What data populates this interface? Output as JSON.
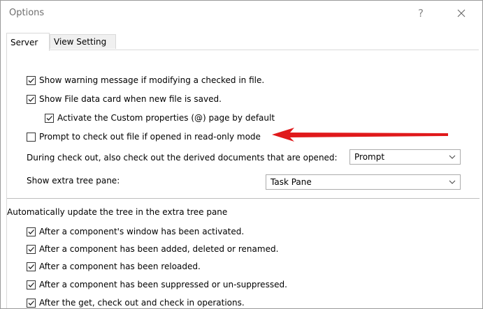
{
  "window": {
    "title": "Options",
    "help_glyph": "?"
  },
  "tabs": [
    {
      "label": "Server",
      "active": true
    },
    {
      "label": "View Setting",
      "active": false
    }
  ],
  "server": {
    "options": [
      {
        "label": "Show warning message if modifying a checked in file.",
        "checked": true
      },
      {
        "label": "Show File data card when new file is saved.",
        "checked": true
      },
      {
        "label": "Activate the Custom properties (@) page by default",
        "checked": true
      },
      {
        "label": "Prompt to check out file if opened in read-only mode",
        "checked": false
      }
    ],
    "derived_label": "During check out, also check out the derived documents that are opened:",
    "derived_value": "Prompt",
    "tree_pane_label": "Show extra tree pane:",
    "tree_pane_value": "Task Pane"
  },
  "auto_update": {
    "heading": "Automatically update the tree in the extra tree pane",
    "options": [
      {
        "label": "After a component's window has been activated.",
        "checked": true
      },
      {
        "label": "After a component has been added, deleted or renamed.",
        "checked": true
      },
      {
        "label": "After a component has been reloaded.",
        "checked": true
      },
      {
        "label": "After a component has been suppressed or un-suppressed.",
        "checked": true
      },
      {
        "label": "After the get, check out and check in operations.",
        "checked": true
      }
    ]
  },
  "colors": {
    "annotation_arrow": "#e0191b",
    "title_text": "#6e6e6e"
  },
  "icons": {
    "close": "close-icon",
    "checkbox_mark": "checkmark-icon",
    "dropdown": "chevron-down-icon"
  }
}
